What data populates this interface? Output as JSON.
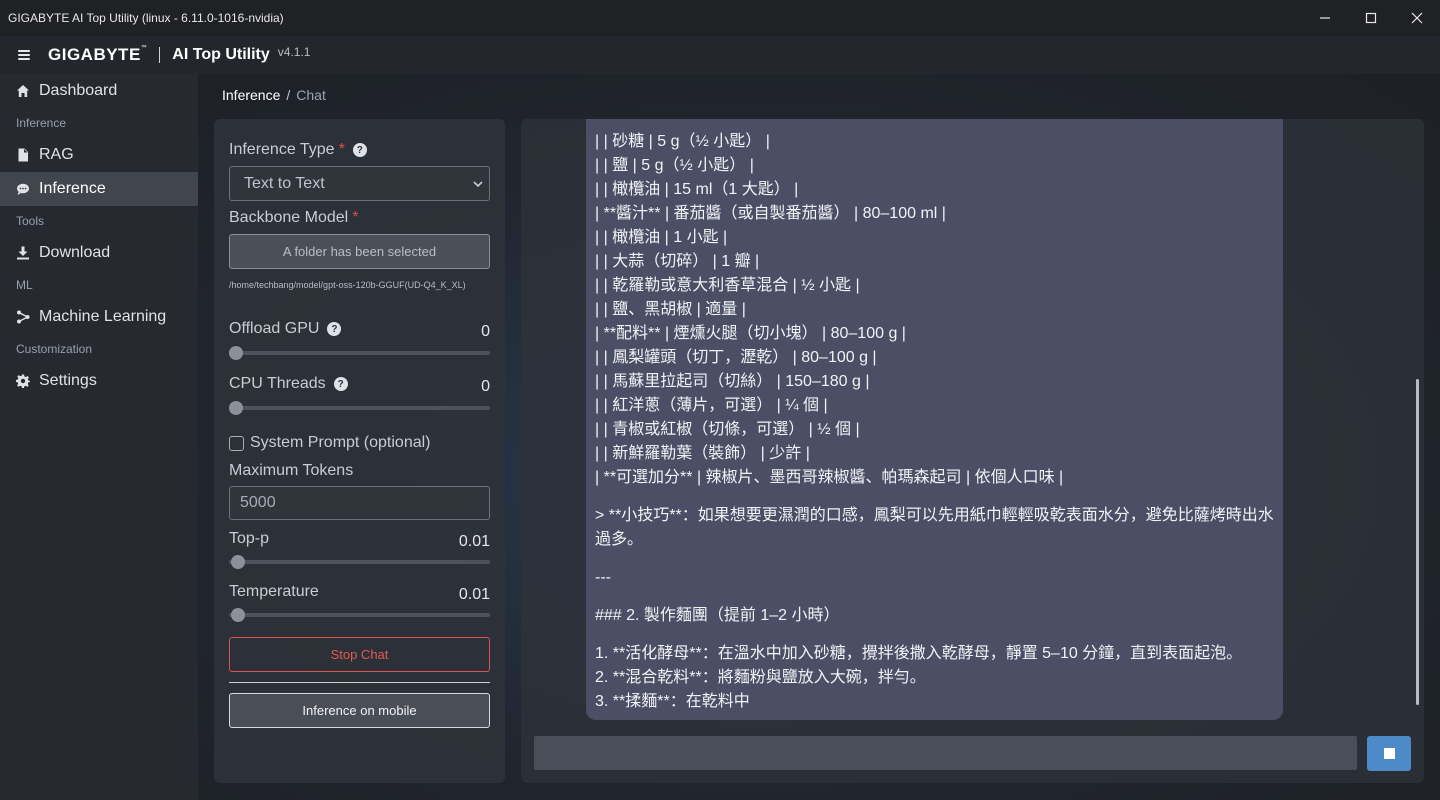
{
  "window": {
    "title": "GIGABYTE AI Top Utility (linux - 6.11.0-1016-nvidia)",
    "minimize": "minimize",
    "maximize": "maximize",
    "close": "close"
  },
  "header": {
    "brand": "GIGABYTE",
    "tm": "™",
    "product": "AI Top Utility",
    "version": "v4.1.1"
  },
  "sidebar": {
    "items": [
      {
        "type": "item",
        "label": "Dashboard",
        "icon": "home-icon"
      },
      {
        "type": "section",
        "label": "Inference"
      },
      {
        "type": "item",
        "label": "RAG",
        "icon": "document-icon"
      },
      {
        "type": "item",
        "label": "Inference",
        "icon": "chat-bubble-icon",
        "active": true
      },
      {
        "type": "section",
        "label": "Tools"
      },
      {
        "type": "item",
        "label": "Download",
        "icon": "download-icon"
      },
      {
        "type": "section",
        "label": "ML"
      },
      {
        "type": "item",
        "label": "Machine Learning",
        "icon": "network-icon"
      },
      {
        "type": "section",
        "label": "Customization"
      },
      {
        "type": "item",
        "label": "Settings",
        "icon": "gear-icon"
      }
    ]
  },
  "breadcrumb": {
    "parent": "Inference",
    "separator": "/",
    "current": "Chat"
  },
  "settings": {
    "inference_type_label": "Inference Type",
    "required_mark": "*",
    "help_mark": "?",
    "inference_type_value": "Text to Text",
    "backbone_label": "Backbone Model",
    "folder_button": "A folder has been selected",
    "model_path": "/home/techbang/model/gpt-oss-120b-GGUF(UD-Q4_K_XL)",
    "offload_gpu_label": "Offload GPU",
    "offload_gpu_value": "0",
    "offload_gpu_fraction": 0,
    "cpu_threads_label": "CPU Threads",
    "cpu_threads_value": "0",
    "cpu_threads_fraction": 0,
    "system_prompt_label": "System Prompt (optional)",
    "max_tokens_label": "Maximum Tokens",
    "max_tokens_value": "5000",
    "top_p_label": "Top-p",
    "top_p_value": "0.01",
    "top_p_fraction": 0.01,
    "temperature_label": "Temperature",
    "temperature_value": "0.01",
    "temperature_fraction": 0.01,
    "stop_button": "Stop Chat",
    "mobile_button": "Inference on mobile"
  },
  "chat": {
    "lines": [
      "| | 砂糖 | 5 g（½ 小匙） |",
      "| | 鹽 | 5 g（½ 小匙） |",
      "| | 橄欖油 | 15 ml（1 大匙） |",
      "| **醬汁** | 番茄醬（或自製番茄醬） | 80–100 ml |",
      "| | 橄欖油 | 1 小匙 |",
      "| | 大蒜（切碎） | 1 瓣 |",
      "| | 乾羅勒或意大利香草混合 | ½ 小匙 |",
      "| | 鹽、黑胡椒 | 適量 |",
      "| **配料** | 煙燻火腿（切小塊） | 80–100 g |",
      "| | 鳳梨罐頭（切丁，瀝乾） | 80–100 g |",
      "| | 馬蘇里拉起司（切絲） | 150–180 g |",
      "| | 紅洋蔥（薄片，可選） | ¼ 個 |",
      "| | 青椒或紅椒（切條，可選） | ½ 個 |",
      "| | 新鮮羅勒葉（裝飾） | 少許 |",
      "| **可選加分** | 辣椒片、墨西哥辣椒醬、帕瑪森起司 | 依個人口味 |"
    ],
    "tip": "> **小技巧**：如果想要更濕潤的口感，鳳梨可以先用紙巾輕輕吸乾表面水分，避免比薩烤時出水過多。",
    "rule": "---",
    "heading": "### 2. 製作麵團（提前 1–2 小時）",
    "steps": [
      "1. **活化酵母**：在溫水中加入砂糖，攪拌後撒入乾酵母，靜置 5–10 分鐘，直到表面起泡。",
      "2. **混合乾料**：將麵粉與鹽放入大碗，拌勻。",
      "3. **揉麵**：在乾料中"
    ]
  },
  "colors": {
    "accent": "#4f8ac8",
    "danger": "#e05a56",
    "required": "#e04b4b",
    "bubble": "#4b4f66"
  }
}
